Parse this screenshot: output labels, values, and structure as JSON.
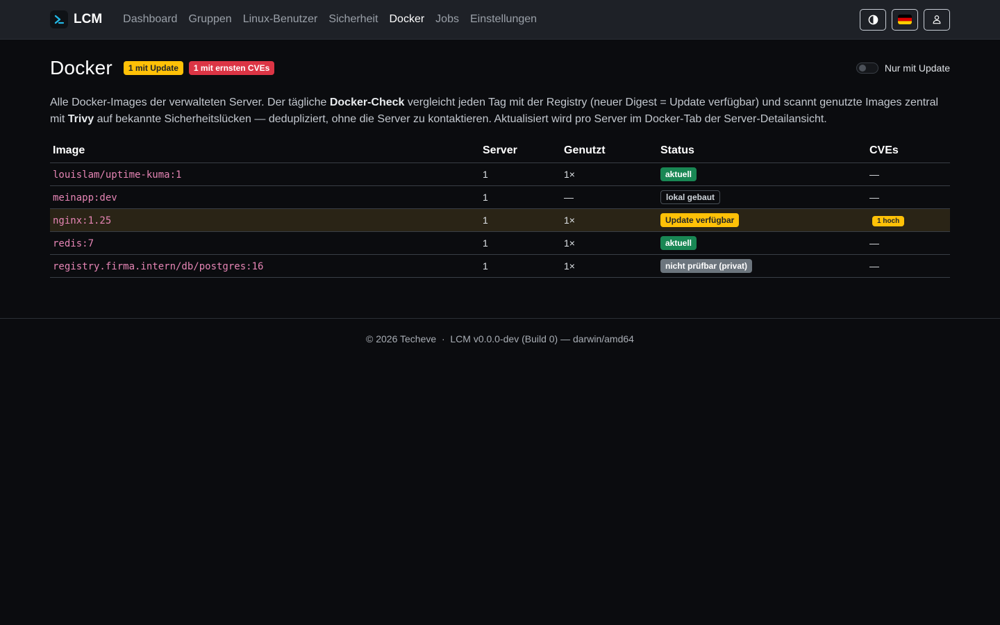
{
  "nav": {
    "brand": "LCM",
    "links": [
      "Dashboard",
      "Gruppen",
      "Linux-Benutzer",
      "Sicherheit",
      "Docker",
      "Jobs",
      "Einstellungen"
    ],
    "active": "Docker"
  },
  "page": {
    "title": "Docker",
    "badge_update": "1 mit Update",
    "badge_cves": "1 mit ernsten CVEs",
    "toggle_label": "Nur mit Update",
    "toggle_on": false,
    "desc_1": "Alle Docker-Images der verwalteten Server. Der tägliche ",
    "desc_bold_1": "Docker-Check",
    "desc_2": " vergleicht jeden Tag mit der Registry (neuer Digest = Update verfügbar) und scannt genutzte Images zentral mit ",
    "desc_bold_2": "Trivy",
    "desc_3": " auf bekannte Sicherheitslücken — dedupliziert, ohne die Server zu kontaktieren. Aktualisiert wird pro Server im Docker-Tab der Server-Detailansicht."
  },
  "table": {
    "headers": [
      "Image",
      "Server",
      "Genutzt",
      "Status",
      "CVEs"
    ],
    "rows": [
      {
        "image": "louislam/uptime-kuma:1",
        "server": "1",
        "used": "1×",
        "status": "aktuell",
        "cves": "—"
      },
      {
        "image": "meinapp:dev",
        "server": "1",
        "used": "—",
        "status": "lokal gebaut",
        "cves": "—"
      },
      {
        "image": "nginx:1.25",
        "server": "1",
        "used": "1×",
        "status": "Update verfügbar",
        "cves": "1 hoch"
      },
      {
        "image": "redis:7",
        "server": "1",
        "used": "1×",
        "status": "aktuell",
        "cves": "—"
      },
      {
        "image": "registry.firma.intern/db/postgres:16",
        "server": "1",
        "used": "1×",
        "status": "nicht prüfbar (privat)",
        "cves": "—"
      }
    ]
  },
  "footer": {
    "text": "© 2026 Techeve  ·  LCM v0.0.0-dev (Build 0) — darwin/amd64"
  }
}
